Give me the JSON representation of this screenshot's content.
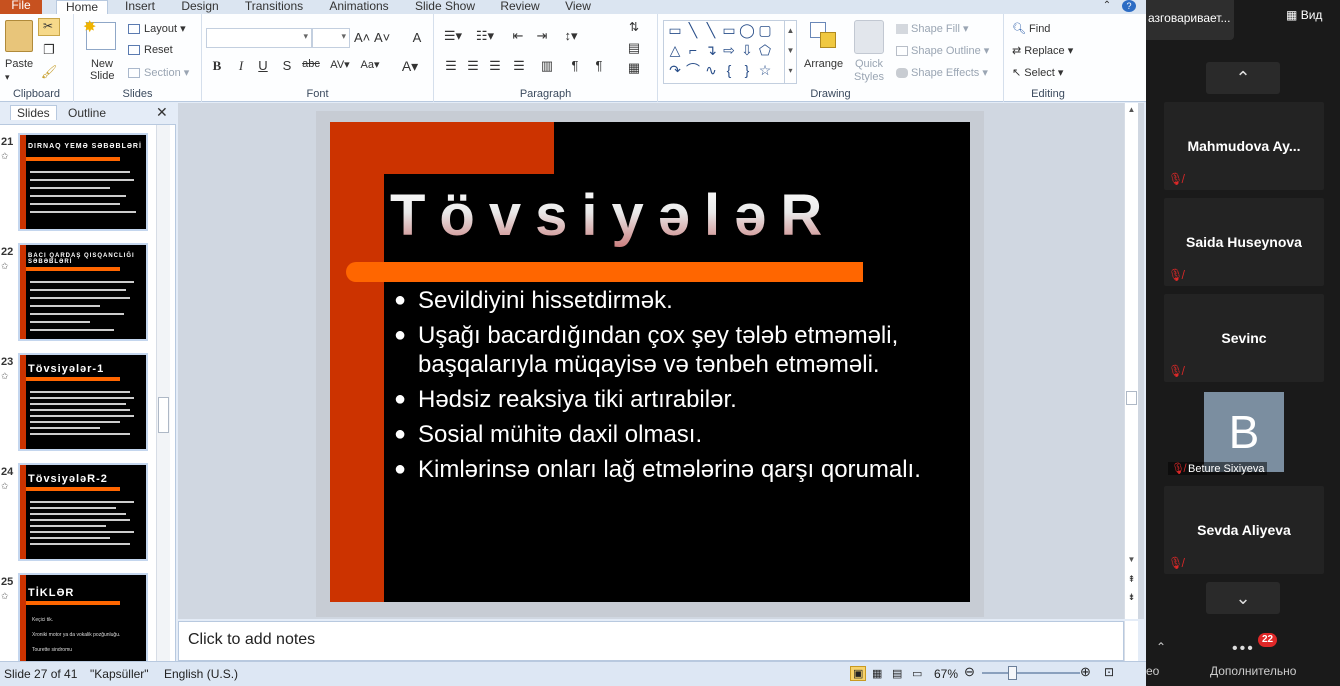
{
  "ribbon_tabs": [
    "File",
    "Home",
    "Insert",
    "Design",
    "Transitions",
    "Animations",
    "Slide Show",
    "Review",
    "View"
  ],
  "groups": {
    "clipboard": {
      "label": "Clipboard",
      "paste": "Paste"
    },
    "slides": {
      "label": "Slides",
      "new_slide": "New Slide",
      "layout": "Layout",
      "reset": "Reset",
      "section": "Section"
    },
    "font": {
      "label": "Font"
    },
    "paragraph": {
      "label": "Paragraph"
    },
    "drawing": {
      "label": "Drawing",
      "arrange": "Arrange",
      "quick_styles": "Quick Styles",
      "shape_fill": "Shape Fill",
      "shape_outline": "Shape Outline",
      "shape_effects": "Shape Effects"
    },
    "editing": {
      "label": "Editing",
      "find": "Find",
      "replace": "Replace",
      "select": "Select"
    }
  },
  "panel_tabs": {
    "slides": "Slides",
    "outline": "Outline"
  },
  "thumbnails": [
    {
      "num": "21",
      "title": "DIRNAQ YEMƏ SƏBƏBLƏRİ"
    },
    {
      "num": "22",
      "title": "BACI QARDAŞ QISQANCLIĞI SƏBƏBLƏRİ"
    },
    {
      "num": "23",
      "title": "Tövsiyələr-1"
    },
    {
      "num": "24",
      "title": "TövsiyələR-2"
    },
    {
      "num": "25",
      "title": "TİKLƏR"
    }
  ],
  "thumbnail25_items": [
    "Keçici tik.",
    "Xroniki motor ya da vokalik pozğunluğu.",
    "Tourette sindromu"
  ],
  "slide": {
    "title": "TövsiyələR",
    "bullets": [
      "Sevildiyini hissetdirmək.",
      "Uşağı bacardığından çox şey tələb etməməli, başqalarıyla müqayisə və tənbeh etməməli.",
      "Hədsiz reaksiya tiki artırabilər.",
      "Sosial mühitə daxil olması.",
      "Kimlərinsə onları lağ etmələrinə qarşı qorumalı."
    ]
  },
  "notes_placeholder": "Click to add notes",
  "status": {
    "slide": "Slide 27 of 41",
    "theme": "\"Kapsüller\"",
    "language": "English (U.S.)",
    "zoom": "67%"
  },
  "zoom_meeting": {
    "top_text": "азговаривает...",
    "view_label": "Вид",
    "participants": [
      "Mahmudova Ay...",
      "Saida Huseynova",
      "Sevinc",
      "Beture Sixiyeva",
      "Sevda Aliyeva"
    ],
    "avatar_letter": "B",
    "bottom_left": "ео",
    "more_label": "Дополнительно",
    "badge": "22"
  }
}
